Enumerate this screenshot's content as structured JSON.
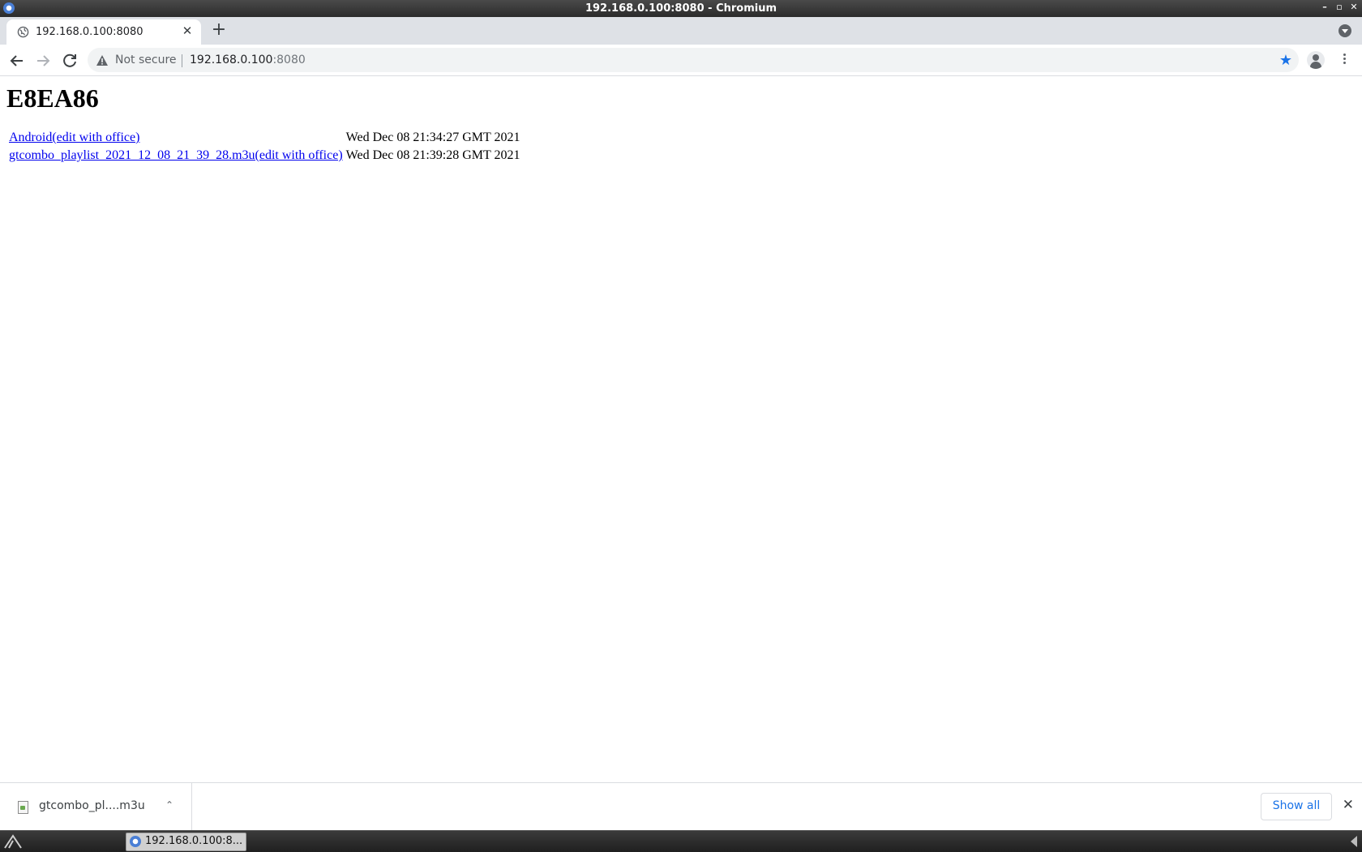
{
  "window": {
    "title": "192.168.0.100:8080 - Chromium"
  },
  "tab": {
    "title": "192.168.0.100:8080"
  },
  "omnibox": {
    "security_label": "Not secure",
    "host": "192.168.0.100",
    "port": ":8080"
  },
  "page": {
    "heading": "E8EA86",
    "files": [
      {
        "name": "Android(edit with office)",
        "date": "Wed Dec 08 21:34:27 GMT 2021"
      },
      {
        "name": "gtcombo_playlist_2021_12_08_21_39_28.m3u(edit with office)",
        "date": "Wed Dec 08 21:39:28 GMT 2021"
      }
    ]
  },
  "downloads": {
    "item_name": "gtcombo_pl....m3u",
    "show_all_label": "Show all"
  },
  "taskbar": {
    "task_label": "192.168.0.100:8..."
  },
  "colors": {
    "link": "#0000ee",
    "accent": "#1a73e8",
    "tabstrip": "#dee1e6"
  }
}
